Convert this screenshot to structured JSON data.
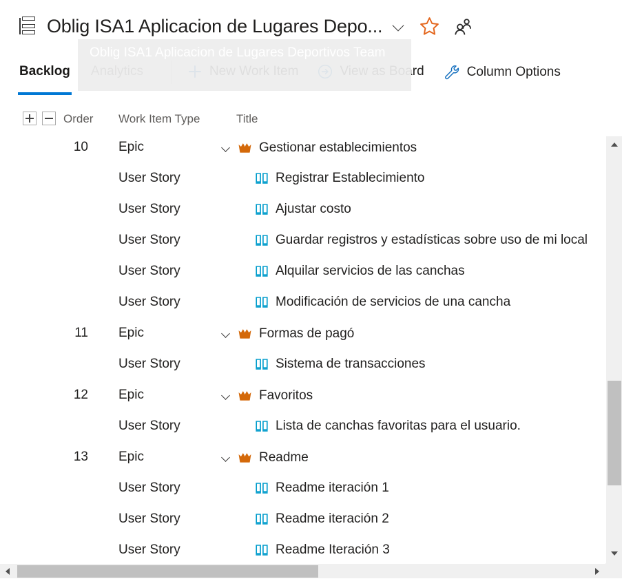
{
  "header": {
    "backlog_icon": "backlog-list-icon",
    "title": "Oblig ISA1 Aplicacion de Lugares Depo...",
    "chevron_icon": "chevron-down-icon",
    "favorite_icon": "star-icon",
    "team_icon": "people-icon"
  },
  "tooltip": {
    "text": "Oblig ISA1 Aplicacion de Lugares Deportivos Team"
  },
  "tabs": [
    {
      "label": "Backlog",
      "active": true
    },
    {
      "label": "Analytics",
      "active": false
    }
  ],
  "commands": [
    {
      "label": "New Work Item",
      "icon": "plus-icon"
    },
    {
      "label": "View as Board",
      "icon": "arrow-circle-right-icon"
    },
    {
      "label": "Column Options",
      "icon": "wrench-icon"
    }
  ],
  "grid": {
    "expand_all_label": "+",
    "collapse_all_label": "−",
    "columns": [
      "Order",
      "Work Item Type",
      "Title"
    ],
    "rows": [
      {
        "order": "10",
        "type": "Epic",
        "title": "Gestionar establecimientos",
        "level": "epic",
        "icon": "crown-icon"
      },
      {
        "order": "",
        "type": "User Story",
        "title": "Registrar Establecimiento",
        "level": "story",
        "icon": "book-icon"
      },
      {
        "order": "",
        "type": "User Story",
        "title": "Ajustar costo",
        "level": "story",
        "icon": "book-icon"
      },
      {
        "order": "",
        "type": "User Story",
        "title": "Guardar registros y estadísticas sobre uso de mi local",
        "level": "story",
        "icon": "book-icon"
      },
      {
        "order": "",
        "type": "User Story",
        "title": "Alquilar servicios de las canchas",
        "level": "story",
        "icon": "book-icon"
      },
      {
        "order": "",
        "type": "User Story",
        "title": "Modificación de servicios de una cancha",
        "level": "story",
        "icon": "book-icon"
      },
      {
        "order": "11",
        "type": "Epic",
        "title": "Formas de pagó",
        "level": "epic",
        "icon": "crown-icon"
      },
      {
        "order": "",
        "type": "User Story",
        "title": "Sistema de transacciones",
        "level": "story",
        "icon": "book-icon"
      },
      {
        "order": "12",
        "type": "Epic",
        "title": "Favoritos",
        "level": "epic",
        "icon": "crown-icon"
      },
      {
        "order": "",
        "type": "User Story",
        "title": "Lista de canchas favoritas para el usuario.",
        "level": "story",
        "icon": "book-icon"
      },
      {
        "order": "13",
        "type": "Epic",
        "title": "Readme",
        "level": "epic",
        "icon": "crown-icon"
      },
      {
        "order": "",
        "type": "User Story",
        "title": "Readme iteración 1",
        "level": "story",
        "icon": "book-icon"
      },
      {
        "order": "",
        "type": "User Story",
        "title": "Readme iteración 2",
        "level": "story",
        "icon": "book-icon"
      },
      {
        "order": "",
        "type": "User Story",
        "title": "Readme Iteración 3",
        "level": "story",
        "icon": "book-icon"
      }
    ]
  },
  "scrollbars": {
    "vertical": {
      "up_icon": "scroll-up-arrow-icon",
      "down_icon": "scroll-down-arrow-icon"
    },
    "horizontal": {
      "left_icon": "scroll-left-arrow-icon",
      "right_icon": "scroll-right-arrow-icon"
    }
  },
  "colors": {
    "accent": "#0078d4",
    "epic": "#d4690a",
    "story": "#009ccc",
    "favorite": "#e3651b",
    "scroll_thumb": "#c0c0c0"
  }
}
